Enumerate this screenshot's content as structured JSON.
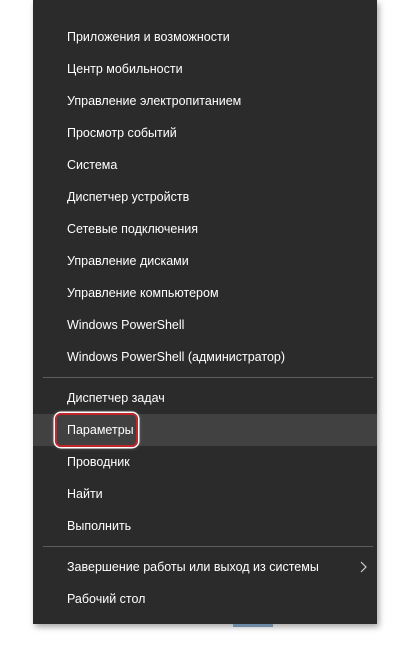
{
  "menu": {
    "items": [
      {
        "label": "Приложения и возможности"
      },
      {
        "label": "Центр мобильности"
      },
      {
        "label": "Управление электропитанием"
      },
      {
        "label": "Просмотр событий"
      },
      {
        "label": "Система"
      },
      {
        "label": "Диспетчер устройств"
      },
      {
        "label": "Сетевые подключения"
      },
      {
        "label": "Управление дисками"
      },
      {
        "label": "Управление компьютером"
      },
      {
        "label": "Windows PowerShell"
      },
      {
        "label": "Windows PowerShell (администратор)"
      },
      {
        "label": "Диспетчер задач"
      },
      {
        "label": "Параметры"
      },
      {
        "label": "Проводник"
      },
      {
        "label": "Найти"
      },
      {
        "label": "Выполнить"
      },
      {
        "label": "Завершение работы или выход из системы"
      },
      {
        "label": "Рабочий стол"
      }
    ],
    "hovered_item": "Параметры",
    "submenu_arrow_icon": "chevron-right-icon"
  },
  "colors": {
    "menu_background": "#2b2b2b",
    "hover_background": "#414141",
    "separator": "#5e5e5e",
    "highlight_border": "#c0262b",
    "text": "#ffffff"
  }
}
